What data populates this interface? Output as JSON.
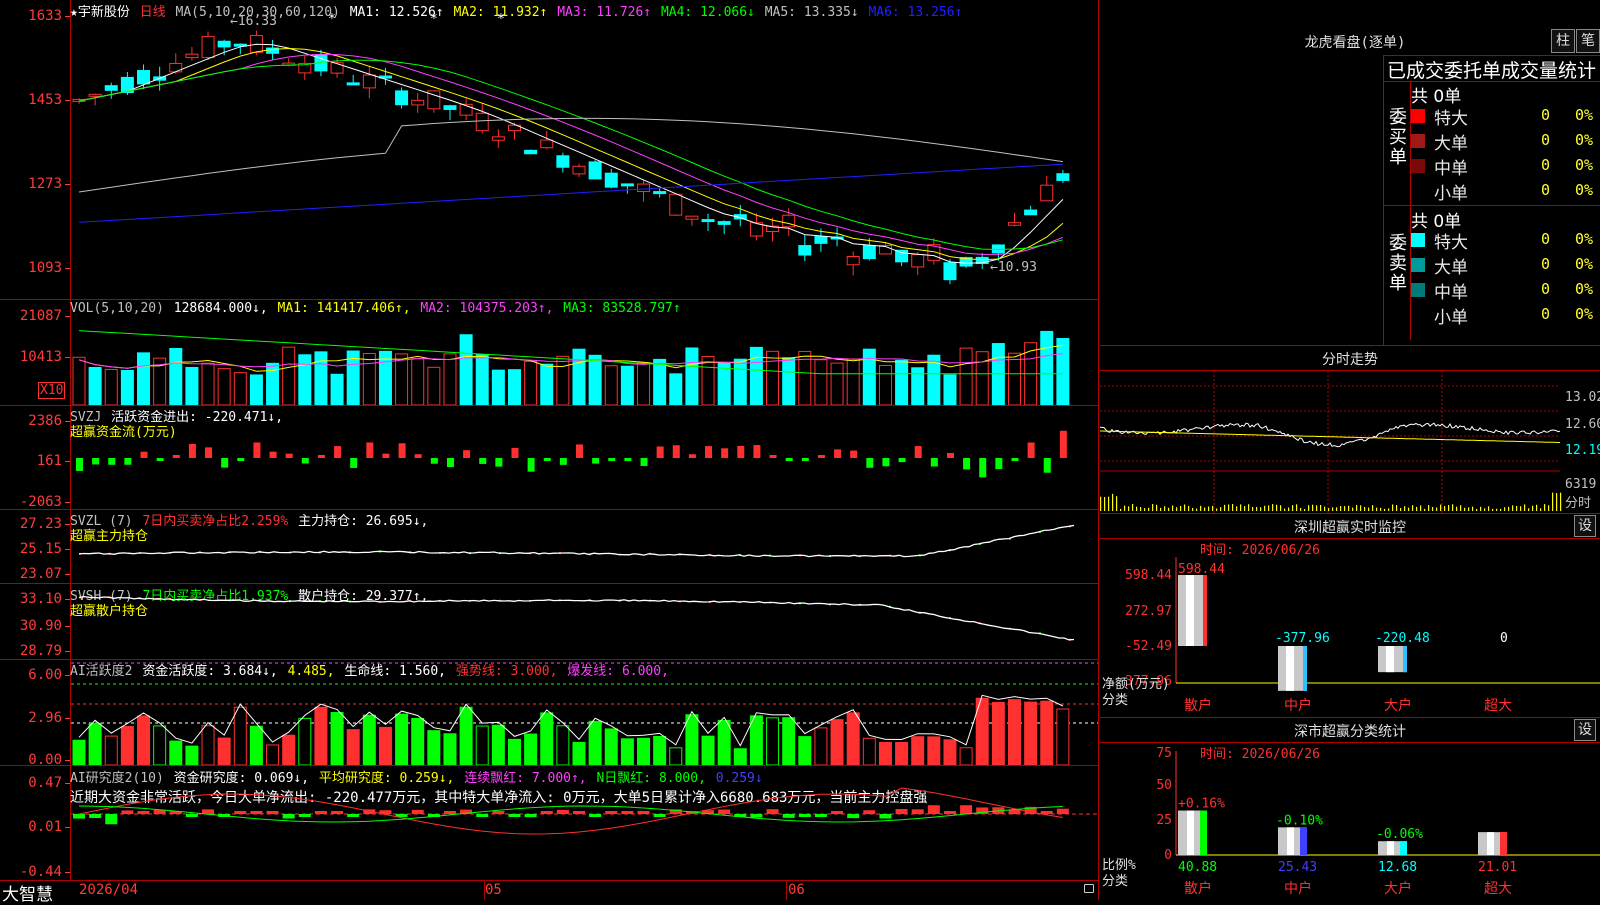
{
  "stock": {
    "name": "★宇新股份",
    "period": "日线"
  },
  "kline": {
    "ma_title": "MA(5,10,20,30,60,120)",
    "ma": [
      {
        "label": "MA1: 12.526↑",
        "color": "#ffffff"
      },
      {
        "label": "MA2: 11.932↑",
        "color": "#ffff00"
      },
      {
        "label": "MA3: 11.726↑",
        "color": "#ff40ff"
      },
      {
        "label": "MA4: 12.066↓",
        "color": "#00ff00"
      },
      {
        "label": "MA5: 13.335↓",
        "color": "#c0c0c0"
      },
      {
        "label": "MA6: 13.256↑",
        "color": "#2020ff"
      }
    ],
    "y_labels": [
      "1633",
      "1453",
      "1273",
      "1093"
    ],
    "hi_note": "←16.33",
    "lo_note": "←10.93",
    "star_marks": [
      "*",
      "*",
      "*"
    ]
  },
  "vol": {
    "title": "VOL(5,10,20)",
    "value": "128684.000↓,",
    "ma": [
      {
        "label": "MA1: 141417.406↑,",
        "color": "#ffff00"
      },
      {
        "label": "MA2: 104375.203↑,",
        "color": "#ff40ff"
      },
      {
        "label": "MA3: 83528.797↑",
        "color": "#00ff00"
      }
    ],
    "y_labels": [
      "21087",
      "10413"
    ],
    "unit": "X10"
  },
  "svzj": {
    "title": "SVZJ",
    "label1": "活跃资金进出: -220.471↓,",
    "label2": "超赢资金流(万元)",
    "y_labels": [
      "2386",
      "161",
      "-2063"
    ]
  },
  "svzl": {
    "title": "SVZL (7)",
    "label1": "7日内买卖净占比2.259%",
    "label2": "主力持仓: 26.695↓,",
    "label3": "超赢主力持仓",
    "y_labels": [
      "27.23",
      "25.15",
      "23.07"
    ]
  },
  "svsh": {
    "title": "SVSH (7)",
    "label1": "7日内买卖净占比1.937%",
    "label2": "散户持仓: 29.377↑,",
    "label3": "超赢散户持仓",
    "y_labels": [
      "33.10",
      "30.90",
      "28.79"
    ]
  },
  "ai1": {
    "title": "AI活跃度2",
    "label1": "资金活跃度: 3.684↓,",
    "label2": "4.485,",
    "label3": "生命线: 1.560,",
    "label4": "强势线: 3.000,",
    "label5": "爆发线: 6.000,",
    "y_labels": [
      "6.00",
      "2.96",
      "0.00"
    ]
  },
  "ai2": {
    "title": "AI研究度2(10)",
    "label1": "资金研究度: 0.069↓,",
    "label2": "平均研究度: 0.259↓,",
    "label3": "连续飘红: 7.000↑,",
    "label4": "N日飘红: 8.000,",
    "label5": "0.259↓",
    "note": "近期大资金非常活跃，今日大单净流出: -220.477万元，其中特大单净流入: 0万元，大单5日累计净入6680.683万元，当前主力控盘强",
    "y_labels": [
      "0.47",
      "0.01",
      "-0.44"
    ]
  },
  "bottom": {
    "brand": "大智慧",
    "dates": [
      "2026/04",
      "05",
      "06"
    ]
  },
  "longhu": {
    "title": "龙虎看盘(逐单)",
    "btn1": "柱",
    "btn2": "笔",
    "subtitle": "已成交委托单成交量统计",
    "buy_label": "委买单",
    "sell_label": "委卖单",
    "buy_total": "共 0单",
    "sell_total": "共 0单",
    "buy": [
      {
        "name": "特大",
        "val": "0",
        "pct": "0%",
        "color": "#ff0000"
      },
      {
        "name": "大单",
        "val": "0",
        "pct": "0%",
        "color": "#a01818"
      },
      {
        "name": "中单",
        "val": "0",
        "pct": "0%",
        "color": "#7a0a0a"
      },
      {
        "name": "小单",
        "val": "0",
        "pct": "0%",
        "color": "#000000"
      }
    ],
    "sell": [
      {
        "name": "特大",
        "val": "0",
        "pct": "0%",
        "color": "#00ffff"
      },
      {
        "name": "大单",
        "val": "0",
        "pct": "0%",
        "color": "#009a9a"
      },
      {
        "name": "中单",
        "val": "0",
        "pct": "0%",
        "color": "#007a7a"
      },
      {
        "name": "小单",
        "val": "0",
        "pct": "0%",
        "color": "#000000"
      }
    ]
  },
  "fenshi": {
    "title": "分时走势",
    "y_labels": [
      "13.02",
      "12.60",
      "12.19"
    ],
    "vol_label": "6319",
    "unit": "分时"
  },
  "sz_monitor": {
    "title": "深圳超赢实时监控",
    "btn": "设",
    "time": "时间: 2026/06/26",
    "y_labels": [
      "598.44",
      "272.97",
      "-52.49",
      "-377.96"
    ],
    "y_title1": "净额(万元)",
    "y_title2": "分类",
    "bars": [
      {
        "cat": "散户",
        "value": "598.44",
        "color": "#ff3030"
      },
      {
        "cat": "中户",
        "value": "-377.96",
        "color": "#30c0ff"
      },
      {
        "cat": "大户",
        "value": "-220.48",
        "color": "#30c0ff"
      },
      {
        "cat": "超大",
        "value": "0",
        "color": "#ffffff"
      }
    ]
  },
  "sz_class": {
    "title": "深市超赢分类统计",
    "btn": "设",
    "time": "时间: 2026/06/26",
    "y_labels": [
      "75",
      "50",
      "25",
      "0"
    ],
    "y_title1": "比例%",
    "y_title2": "分类",
    "bars": [
      {
        "cat": "散户",
        "ratio": "40.88",
        "change": "+0.16%",
        "ratio_color": "#00ff00",
        "change_color": "#ff3030"
      },
      {
        "cat": "中户",
        "ratio": "25.43",
        "change": "-0.10%",
        "ratio_color": "#4040ff",
        "change_color": "#00ff00"
      },
      {
        "cat": "大户",
        "ratio": "12.68",
        "change": "-0.06%",
        "ratio_color": "#00ffff",
        "change_color": "#00ff00"
      },
      {
        "cat": "超大",
        "ratio": "21.01",
        "change": "",
        "ratio_color": "#ff3030",
        "change_color": "#ff3030"
      }
    ]
  },
  "colors": {
    "up": "#ff3030",
    "down": "#00ffff",
    "grid": "#b00000",
    "axis": "#ff3b3b"
  }
}
